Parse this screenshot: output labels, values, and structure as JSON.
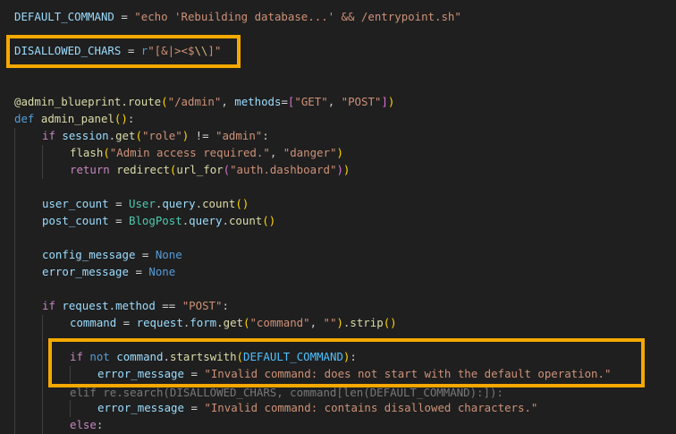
{
  "lines": {
    "l1": {
      "name": "DEFAULT_COMMAND",
      "op": " = ",
      "value": "\"echo 'Rebuilding database...' && /entrypoint.sh\""
    },
    "l2": {
      "name": "DISALLOWED_CHARS",
      "op": " = ",
      "prefix": "r",
      "q1": "\"[&|><$",
      "escape": "\\\\",
      "q2": "]\""
    },
    "l3": {
      "at": "@",
      "obj": "admin_blueprint",
      "dot": ".",
      "method": "route",
      "p1": "(",
      "path": "\"/admin\"",
      "comma": ", ",
      "kwarg": "methods",
      "eq": "=",
      "b1": "[",
      "get": "\"GET\"",
      "comma2": ", ",
      "post": "\"POST\"",
      "b2": "]",
      "p2": ")"
    },
    "l4": {
      "kw": "def",
      "sp": " ",
      "fn": "admin_panel",
      "p1": "(",
      "p2": ")",
      "colon": ":"
    },
    "l5": {
      "kw": "if",
      "sp": " ",
      "obj": "session",
      "dot": ".",
      "method": "get",
      "p1": "(",
      "arg": "\"role\"",
      "p2": ")",
      "op": " != ",
      "val": "\"admin\"",
      "colon": ":"
    },
    "l6": {
      "fn": "flash",
      "p1": "(",
      "arg1": "\"Admin access required.\"",
      "comma": ", ",
      "arg2": "\"danger\"",
      "p2": ")"
    },
    "l7": {
      "kw": "return",
      "sp": " ",
      "fn": "redirect",
      "p1": "(",
      "fn2": "url_for",
      "p2": "(",
      "arg": "\"auth.dashboard\"",
      "p3": ")",
      "p4": ")"
    },
    "l8": {
      "var": "user_count",
      "op": " = ",
      "cls": "User",
      "dot1": ".",
      "attr": "query",
      "dot2": ".",
      "method": "count",
      "p1": "(",
      "p2": ")"
    },
    "l9": {
      "var": "post_count",
      "op": " = ",
      "cls": "BlogPost",
      "dot1": ".",
      "attr": "query",
      "dot2": ".",
      "method": "count",
      "p1": "(",
      "p2": ")"
    },
    "l10": {
      "var": "config_message",
      "op": " = ",
      "val": "None"
    },
    "l11": {
      "var": "error_message",
      "op": " = ",
      "val": "None"
    },
    "l12": {
      "kw": "if",
      "sp": " ",
      "obj": "request",
      "dot": ".",
      "attr": "method",
      "op": " == ",
      "val": "\"POST\"",
      "colon": ":"
    },
    "l13": {
      "var": "command",
      "op": " = ",
      "obj": "request",
      "dot1": ".",
      "attr": "form",
      "dot2": ".",
      "method": "get",
      "p1": "(",
      "arg1": "\"command\"",
      "comma": ", ",
      "arg2": "\"\"",
      "p2": ")",
      "dot3": ".",
      "method2": "strip",
      "p3": "(",
      "p4": ")"
    },
    "l14": {
      "kw1": "if",
      "sp1": " ",
      "kw2": "not",
      "sp2": " ",
      "obj": "command",
      "dot": ".",
      "method": "startswith",
      "p1": "(",
      "arg": "DEFAULT_COMMAND",
      "p2": ")",
      "colon": ":"
    },
    "l15": {
      "var": "error_message",
      "op": " = ",
      "val": "\"Invalid command: does not start with the default operation.\""
    },
    "l16": {
      "text": "elif re.search(DISALLOWED_CHARS, command[len(DEFAULT_COMMAND):]):"
    },
    "l17": {
      "var": "error_message",
      "op": " = ",
      "val": "\"Invalid command: contains disallowed characters.\""
    },
    "l18": {
      "kw": "else",
      "colon": ":"
    }
  },
  "highlight_color": "#f5a800"
}
